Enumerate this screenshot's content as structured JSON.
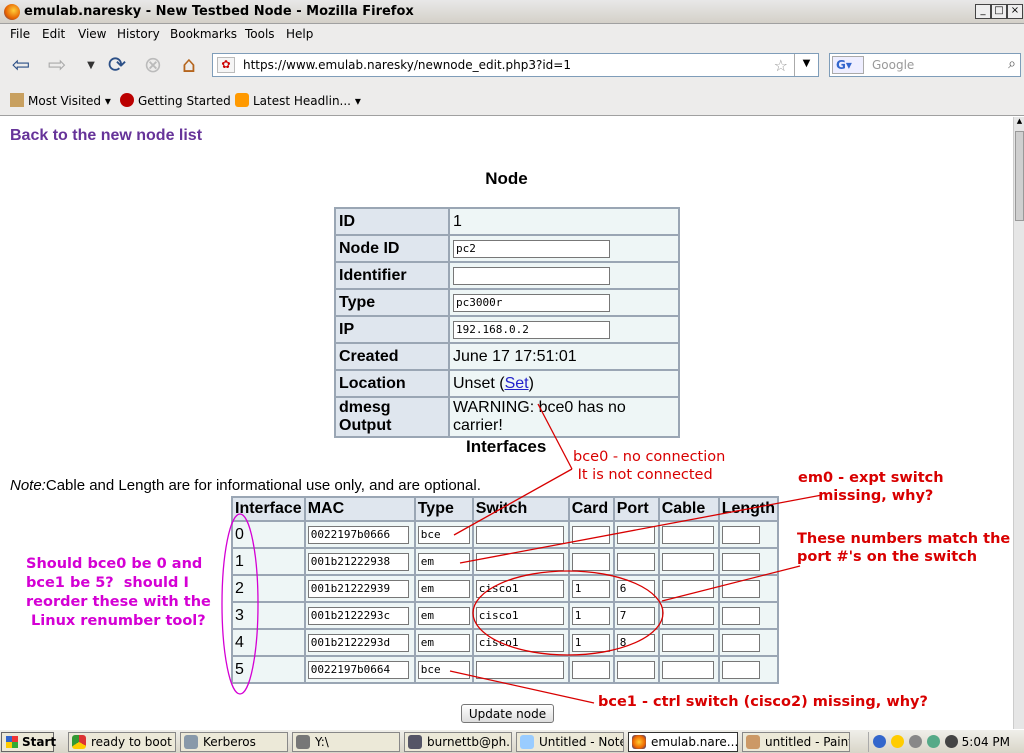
{
  "window": {
    "title": "emulab.naresky - New Testbed Node - Mozilla Firefox"
  },
  "menu": [
    "File",
    "Edit",
    "View",
    "History",
    "Bookmarks",
    "Tools",
    "Help"
  ],
  "nav": {
    "url": "https://www.emulab.naresky/newnode_edit.php3?id=1",
    "search_placeholder": "Google"
  },
  "bookmarks": [
    "Most Visited",
    "Getting Started",
    "Latest Headlin..."
  ],
  "page": {
    "back_link": "Back to the new node list",
    "node_heading": "Node",
    "node_fields": [
      {
        "label": "ID",
        "value": "1",
        "kind": "text"
      },
      {
        "label": "Node ID",
        "value": "pc2",
        "kind": "input"
      },
      {
        "label": "Identifier",
        "value": "",
        "kind": "input"
      },
      {
        "label": "Type",
        "value": "pc3000r",
        "kind": "input"
      },
      {
        "label": "IP",
        "value": "192.168.0.2",
        "kind": "input"
      },
      {
        "label": "Created",
        "value": "June 17 17:51:01",
        "kind": "text"
      },
      {
        "label": "Location",
        "value": "Unset (",
        "link": "Set",
        "suffix": ")",
        "kind": "link"
      },
      {
        "label": "dmesg Output",
        "value": "WARNING: bce0 has no carrier!",
        "kind": "text"
      }
    ],
    "interfaces_heading": "Interfaces",
    "note_label": "Note:",
    "note_text": "Cable and Length are for informational use only, and are optional.",
    "iface_columns": [
      "Interface",
      "MAC",
      "Type",
      "Switch",
      "Card",
      "Port",
      "Cable",
      "Length"
    ],
    "iface_rows": [
      {
        "num": "0",
        "mac": "0022197b0666",
        "type": "bce",
        "switch": "",
        "card": "",
        "port": "",
        "cable": "",
        "length": ""
      },
      {
        "num": "1",
        "mac": "001b21222938",
        "type": "em",
        "switch": "",
        "card": "",
        "port": "",
        "cable": "",
        "length": ""
      },
      {
        "num": "2",
        "mac": "001b21222939",
        "type": "em",
        "switch": "cisco1",
        "card": "1",
        "port": "6",
        "cable": "",
        "length": ""
      },
      {
        "num": "3",
        "mac": "001b2122293c",
        "type": "em",
        "switch": "cisco1",
        "card": "1",
        "port": "7",
        "cable": "",
        "length": ""
      },
      {
        "num": "4",
        "mac": "001b2122293d",
        "type": "em",
        "switch": "cisco1",
        "card": "1",
        "port": "8",
        "cable": "",
        "length": ""
      },
      {
        "num": "5",
        "mac": "0022197b0664",
        "type": "bce",
        "switch": "",
        "card": "",
        "port": "",
        "cable": "",
        "length": ""
      }
    ],
    "update_button": "Update node"
  },
  "annotations": {
    "bce0": "bce0 - no connection\n It is not connected",
    "em0": "em0 - expt switch\n    missing, why?",
    "numbers": "These numbers match the\nport #'s on the switch",
    "bce1": "bce1 - ctrl switch (cisco2) missing, why?",
    "reorder": "Should bce0 be 0 and\nbce1 be 5?  should I\nreorder these with the\n Linux renumber tool?",
    "red_color": "#d80000",
    "magenta_color": "#d400d4"
  },
  "taskbar": {
    "start": "Start",
    "items": [
      "ready to boot ...",
      "Kerberos",
      "Y:\\",
      "burnettb@ph...",
      "Untitled - Note...",
      "emulab.nare...",
      "untitled - Paint"
    ],
    "clock": "5:04 PM"
  }
}
